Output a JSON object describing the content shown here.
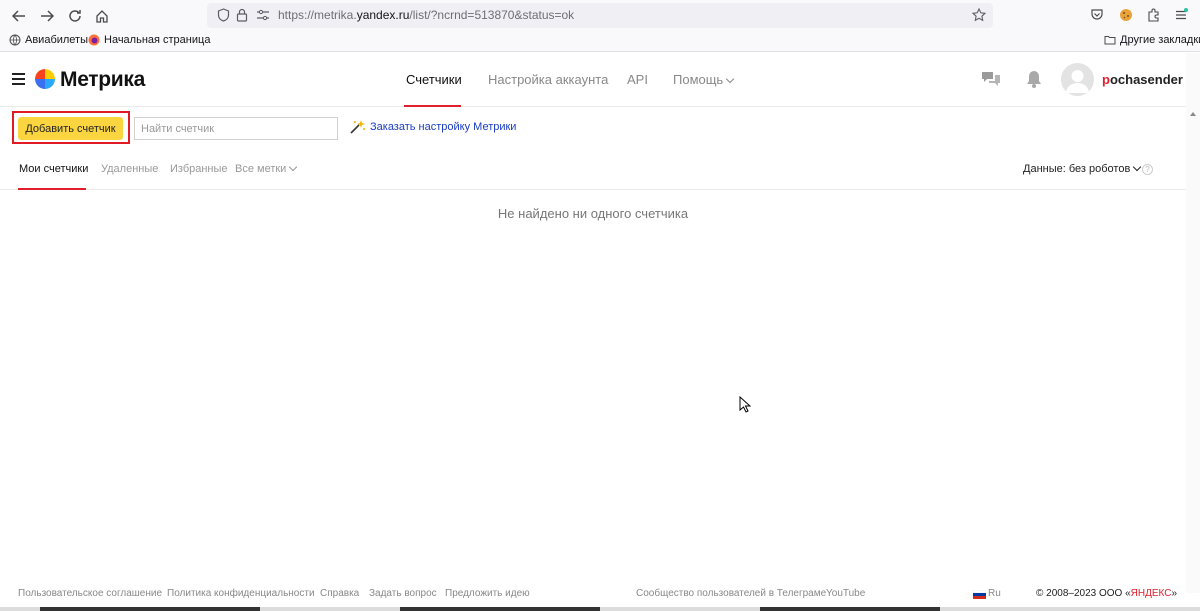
{
  "browser": {
    "url_prefix": "https://metrika.",
    "url_host": "yandex.ru",
    "url_path": "/list/?ncrnd=513870&status=ok",
    "bookmarks": [
      "Авиабилеты",
      "Начальная страница"
    ],
    "other_bookmarks": "Другие закладки"
  },
  "header": {
    "logo_text": "Метрика",
    "tabs": [
      "Счетчики",
      "Настройка аккаунта",
      "API",
      "Помощь"
    ],
    "username_first": "p",
    "username_rest": "ochasender"
  },
  "actions": {
    "add_counter": "Добавить счетчик",
    "search_placeholder": "Найти счетчик",
    "order_setup": "Заказать настройку Метрики"
  },
  "subtabs": {
    "items": [
      "Мои счетчики",
      "Удаленные",
      "Избранные",
      "Все метки"
    ],
    "data_filter": "Данные: без роботов",
    "help": "?"
  },
  "main": {
    "empty_message": "Не найдено ни одного счетчика"
  },
  "footer": {
    "links": [
      "Пользовательское соглашение",
      "Политика конфиденциальности",
      "Справка",
      "Задать вопрос",
      "Предложить идею",
      "Сообщество пользователей в Телеграме",
      "YouTube"
    ],
    "language": "Ru",
    "copyright_prefix": "© 2008–2023 ООО «",
    "copyright_brand": "ЯНДЕКС",
    "copyright_suffix": "»"
  },
  "colors": {
    "accent_red": "#e0202c",
    "button_yellow": "#fbd540",
    "link_blue": "#1a3dc1"
  }
}
